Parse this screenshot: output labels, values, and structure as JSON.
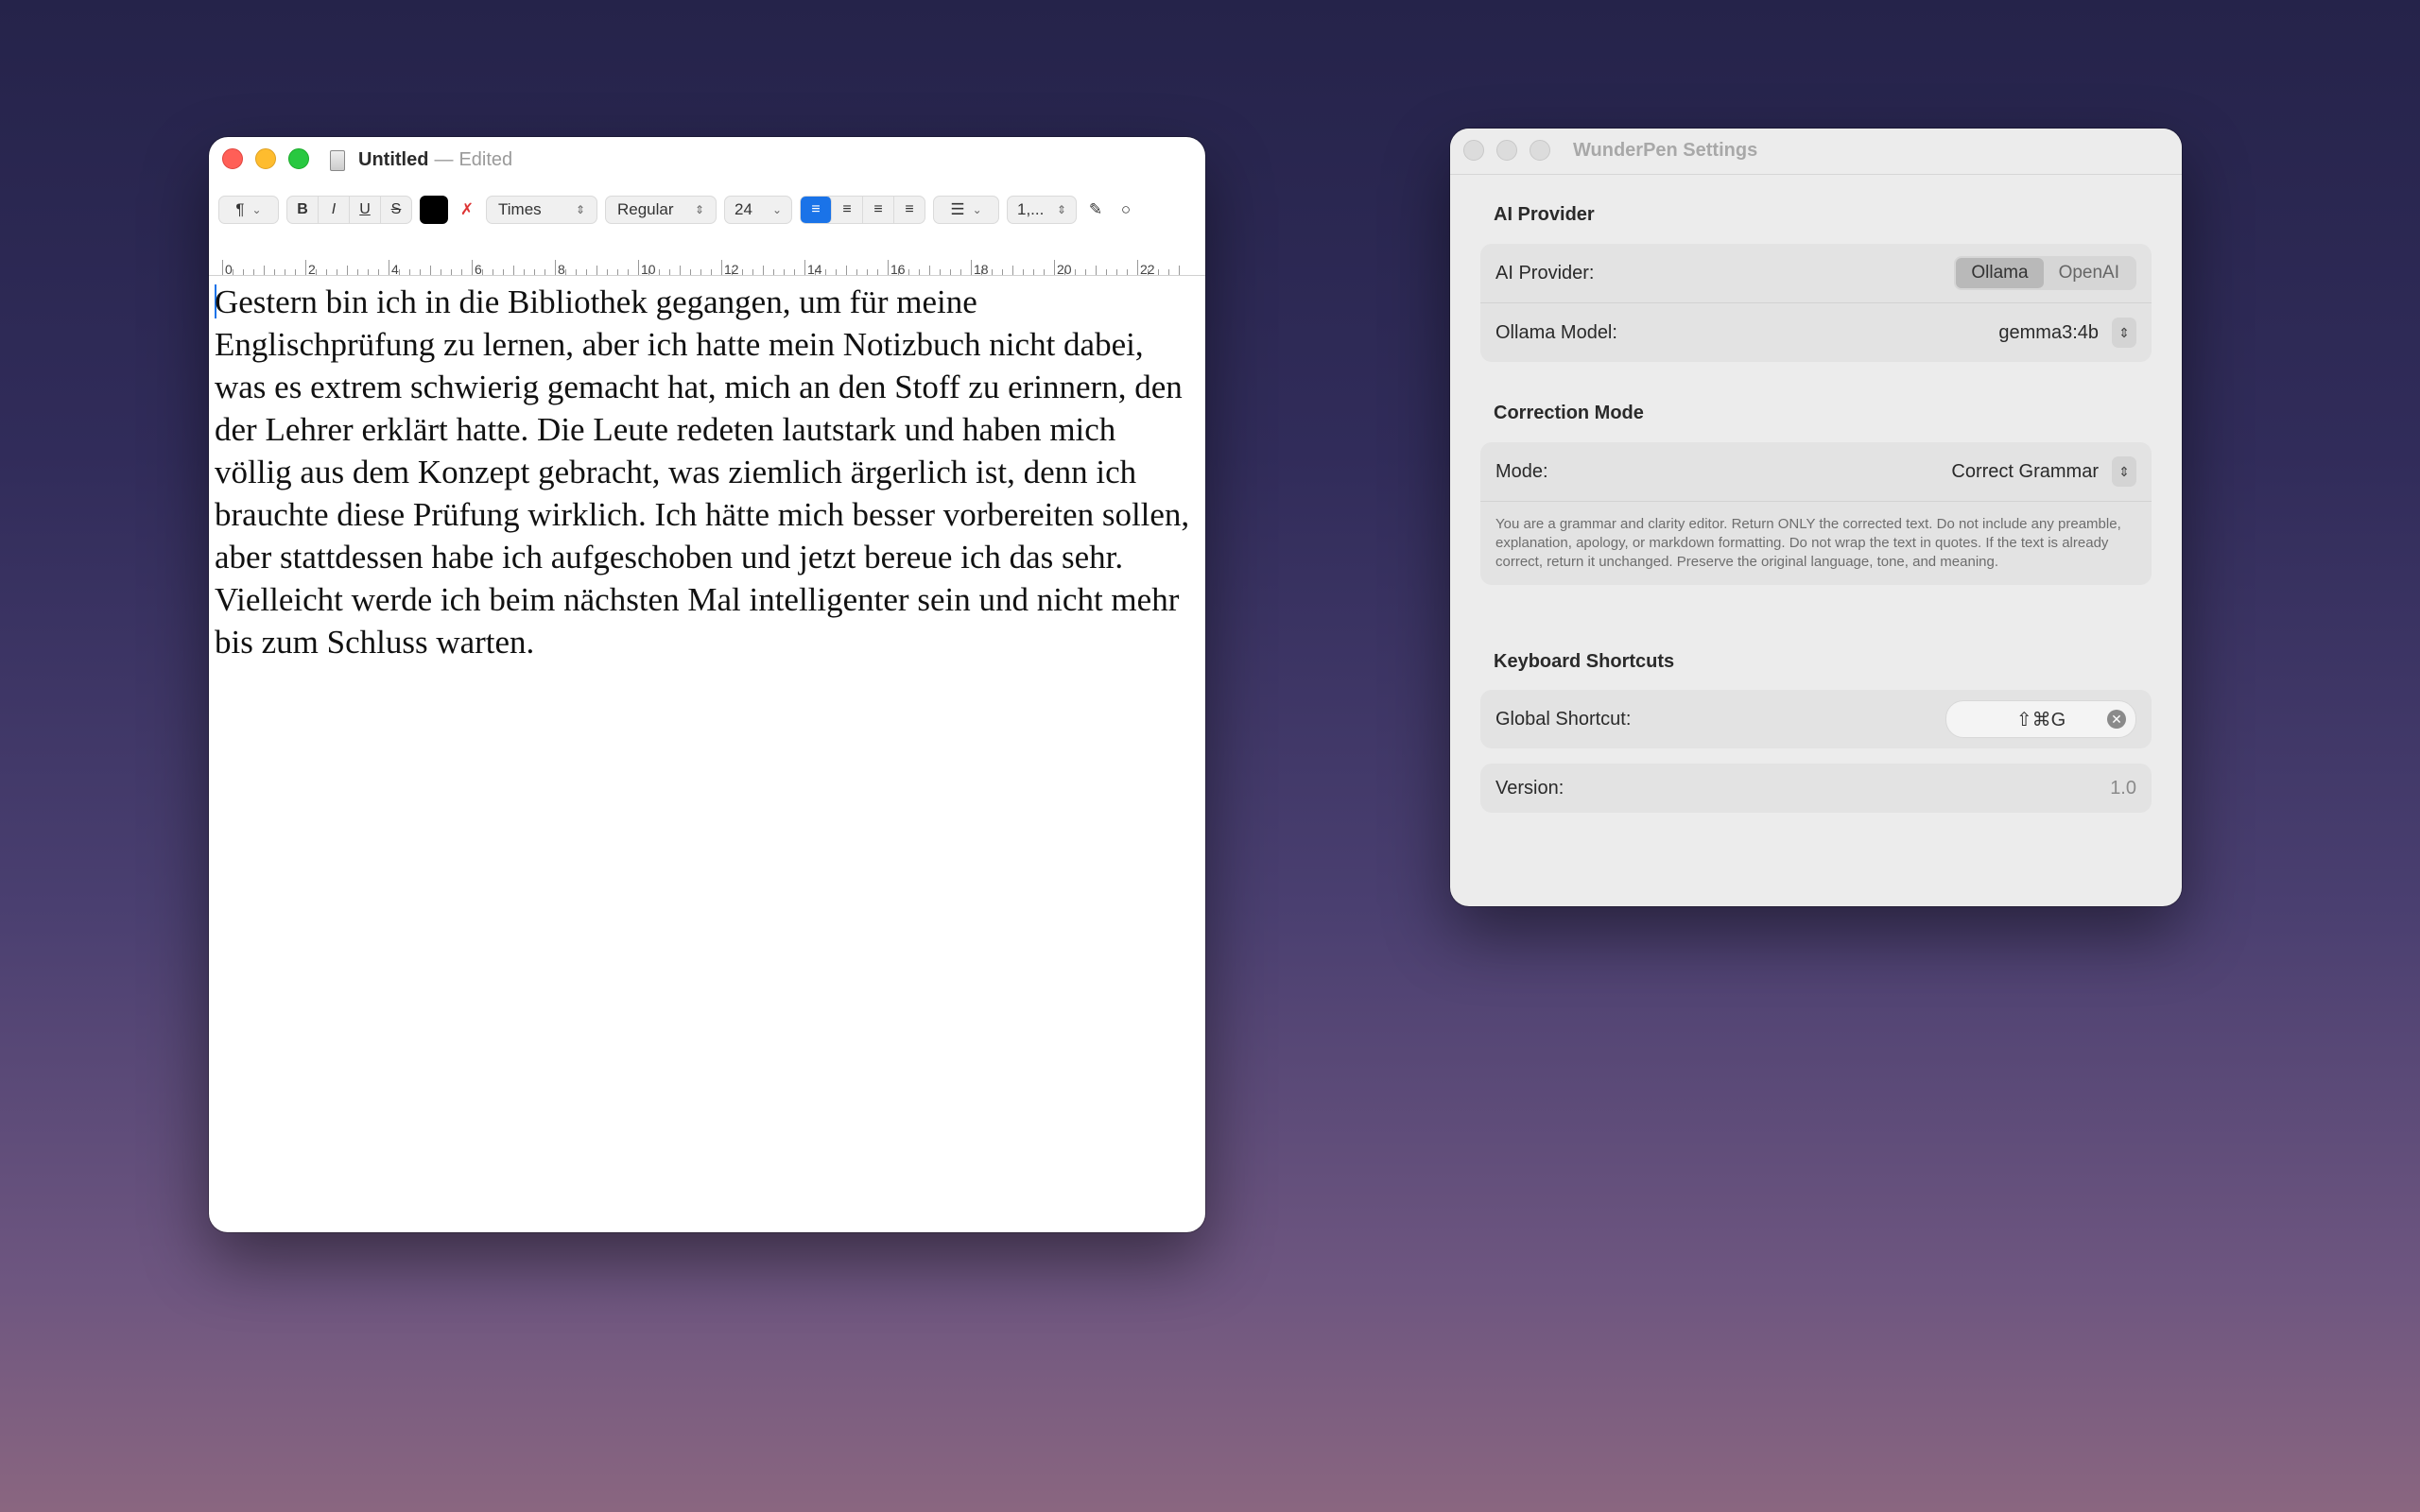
{
  "textedit": {
    "title": "Untitled",
    "separator": "—",
    "status": "Edited",
    "toolbar": {
      "paragraph_style": "¶",
      "bold": "B",
      "italic": "I",
      "underline": "U",
      "strikethrough": "S",
      "clear_style": "✗",
      "font_family": "Times",
      "font_style": "Regular",
      "font_size": "24",
      "line_spacing": "1,..."
    },
    "ruler_labels": [
      "0",
      "2",
      "4",
      "6",
      "8",
      "10",
      "12",
      "14",
      "16",
      "18",
      "20",
      "22"
    ],
    "document_text": "Gestern bin ich in die Bibliothek gegangen, um für meine Englischprüfung zu lernen, aber ich hatte mein Notizbuch nicht dabei, was es extrem schwierig gemacht hat, mich an den Stoff zu erinnern, den der Lehrer erklärt hatte. Die Leute redeten lautstark und haben mich völlig aus dem Konzept gebracht, was ziemlich ärgerlich ist, denn ich brauchte diese Prüfung wirklich. Ich hätte mich besser vorbereiten sollen, aber stattdessen habe ich aufgeschoben und jetzt bereue ich das sehr. Vielleicht werde ich beim nächsten Mal intelligenter sein und nicht mehr bis zum Schluss warten."
  },
  "settings": {
    "title": "WunderPen Settings",
    "ai_provider": {
      "heading": "AI Provider",
      "provider_label": "AI Provider:",
      "options": [
        "Ollama",
        "OpenAI"
      ],
      "selected": "Ollama",
      "model_label": "Ollama Model:",
      "model_value": "gemma3:4b"
    },
    "correction": {
      "heading": "Correction Mode",
      "mode_label": "Mode:",
      "mode_value": "Correct Grammar",
      "prompt_text": "You are a grammar and clarity editor. Return ONLY the corrected text. Do not include any preamble, explanation, apology, or markdown formatting. Do not wrap the text in quotes. If the text is already correct, return it unchanged. Preserve the original language, tone, and meaning."
    },
    "shortcuts": {
      "heading": "Keyboard Shortcuts",
      "global_label": "Global Shortcut:",
      "global_value": "⇧⌘G"
    },
    "version": {
      "label": "Version:",
      "value": "1.0"
    }
  }
}
